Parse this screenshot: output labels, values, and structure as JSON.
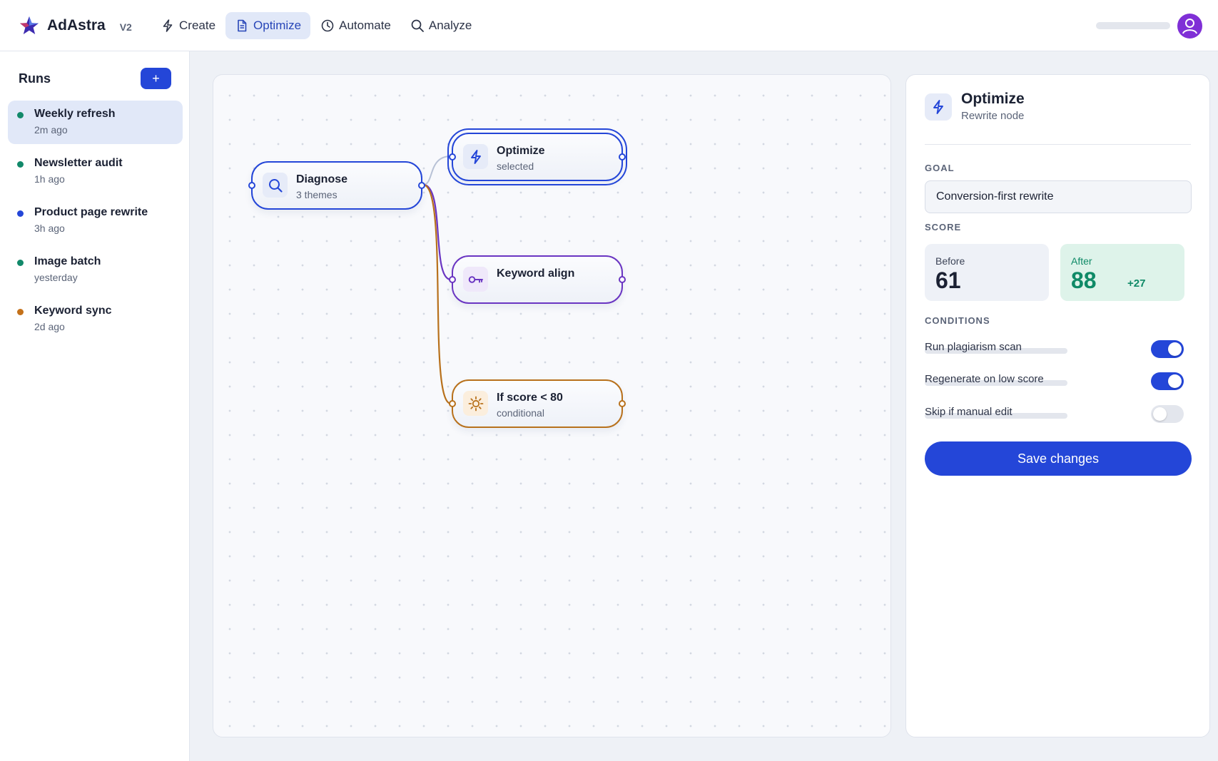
{
  "app": {
    "name": "AdAstra",
    "version": "V2"
  },
  "nav": {
    "items": [
      {
        "label": "Create",
        "icon": "lightning-icon"
      },
      {
        "label": "Optimize",
        "icon": "document-icon",
        "active": true
      },
      {
        "label": "Automate",
        "icon": "clock-icon"
      },
      {
        "label": "Analyze",
        "icon": "search-icon"
      }
    ]
  },
  "sidebar": {
    "title": "Runs",
    "add_label": "+",
    "runs": [
      {
        "name": "Weekly refresh",
        "time": "2m ago",
        "status_color": "#12896a",
        "active": true
      },
      {
        "name": "Newsletter audit",
        "time": "1h ago",
        "status_color": "#12896a"
      },
      {
        "name": "Product page rewrite",
        "time": "3h ago",
        "status_color": "#2446d8"
      },
      {
        "name": "Image batch",
        "time": "yesterday",
        "status_color": "#12896a"
      },
      {
        "name": "Keyword sync",
        "time": "2d ago",
        "status_color": "#c4711a"
      }
    ]
  },
  "canvas": {
    "nodes": [
      {
        "title": "Diagnose",
        "subtitle": "3 themes",
        "icon": "search-icon",
        "color": "#2446d8"
      },
      {
        "title": "Optimize",
        "subtitle": "selected",
        "icon": "lightning-icon",
        "color": "#2446d8",
        "selected": true
      },
      {
        "title": "Keyword align",
        "subtitle": "",
        "icon": "key-icon",
        "color": "#6a35c2"
      },
      {
        "title": "If score < 80",
        "subtitle": "conditional",
        "icon": "sun-icon",
        "color": "#b8711c"
      }
    ]
  },
  "inspector": {
    "title": "Optimize",
    "subtitle": "Rewrite node",
    "goal_label": "GOAL",
    "goal_value": "Conversion-first rewrite",
    "score_label": "SCORE",
    "before_label": "Before",
    "before_value": "61",
    "after_label": "After",
    "after_value": "88",
    "delta": "+27",
    "conditions_label": "CONDITIONS",
    "conditions": [
      {
        "label": "Run plagiarism scan",
        "on": true
      },
      {
        "label": "Regenerate on low score",
        "on": true
      },
      {
        "label": "Skip if manual edit",
        "on": false
      }
    ],
    "save_label": "Save changes"
  },
  "colors": {
    "accent": "#2446d8",
    "success": "#0f8a67",
    "purple": "#6a35c2",
    "amber": "#b8711c"
  }
}
